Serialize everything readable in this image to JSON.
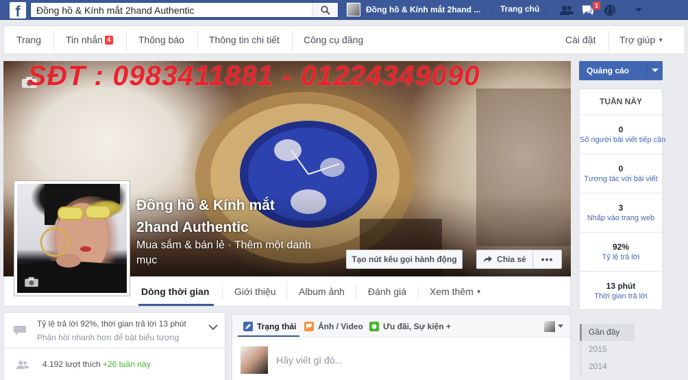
{
  "topbar": {
    "search_value": "Đồng hồ & Kính mắt 2hand Authentic",
    "profile_name": "Đồng hồ & Kính mắt 2hand ...",
    "home_label": "Trang chủ",
    "messages_badge": "1"
  },
  "pagenav": {
    "items": [
      {
        "label": "Trang"
      },
      {
        "label": "Tin nhắn",
        "badge": "4"
      },
      {
        "label": "Thông báo"
      },
      {
        "label": "Thông tin chi tiết"
      },
      {
        "label": "Công cụ đăng"
      }
    ],
    "settings_label": "Cài đặt",
    "help_label": "Trợ giúp"
  },
  "cover": {
    "phone_text": "SĐT : 0983411881 - 01224349090",
    "page_name_line1": "Đồng hồ & Kính mắt",
    "page_name_line2": "2hand Authentic",
    "category_line1": "Mua sắm & bán lẻ · Thêm một danh",
    "category_line2": "mục",
    "cta_label": "Tạo nút kêu gọi hành động",
    "share_label": "Chia sẻ",
    "more_label": "•••"
  },
  "tabs": {
    "timeline": "Dòng thời gian",
    "about": "Giới thiệu",
    "photos": "Album ảnh",
    "reviews": "Đánh giá",
    "more": "Xem thêm"
  },
  "sidebar": {
    "ads_label": "Quảng cáo",
    "week_title": "TUẦN NÀY",
    "stats": [
      {
        "value": "0",
        "label": "Số người bài viết tiếp cận"
      },
      {
        "value": "0",
        "label": "Tương tác với bài viết"
      },
      {
        "value": "3",
        "label": "Nhấp vào trang web"
      },
      {
        "value": "92%",
        "label": "Tỷ lệ trả lời"
      },
      {
        "value": "13 phút",
        "label": "Thời gian trả lời"
      }
    ],
    "years": [
      "Gần đây",
      "2015",
      "2014"
    ]
  },
  "response": {
    "title": "Tỷ lệ trả lời 92%, thời gian trả lời 13 phút",
    "subtitle": "Phản hồi nhanh hơn để bật biểu tượng",
    "likes": "4.192 lượt thích",
    "likes_week": "+26 tuần này"
  },
  "composer": {
    "status_tab": "Trạng thái",
    "photo_tab": "Ảnh / Video",
    "offer_tab": "Ưu đãi, Sự kiện +",
    "placeholder": "Hãy viết gì đó..."
  },
  "colors": {
    "brand_blue": "#3b5998",
    "badge_red": "#fa3e3e",
    "cover_text_red": "#e8232b",
    "link_blue": "#4267b2"
  }
}
